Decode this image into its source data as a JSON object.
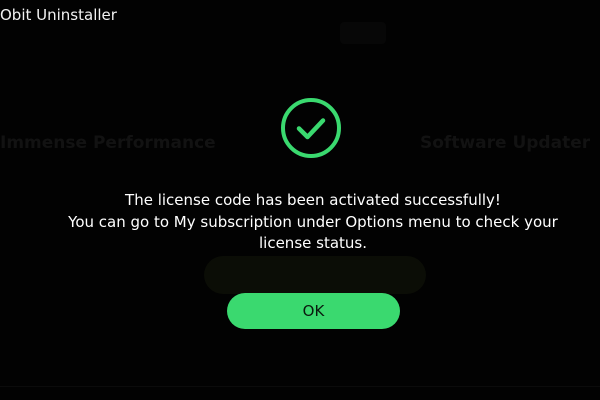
{
  "app": {
    "title": "Obit Uninstaller"
  },
  "background": {
    "heading_left": "Immense Performance",
    "heading_right": "Software Updater"
  },
  "dialog": {
    "icon": "check-circle-icon",
    "message_lines": [
      "The license code has been activated successfully!",
      "You can go to My subscription under Options menu to check your",
      "license status."
    ],
    "ok_label": "OK"
  },
  "colors": {
    "accent": "#3ad96f",
    "background": "#020202",
    "text": "#ffffff"
  }
}
